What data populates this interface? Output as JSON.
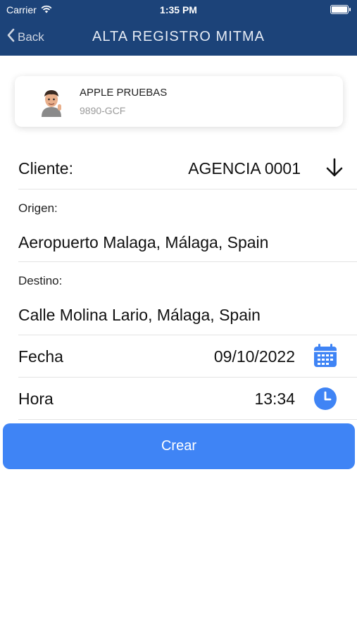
{
  "status_bar": {
    "carrier": "Carrier",
    "time": "1:35 PM"
  },
  "nav": {
    "back_label": "Back",
    "title": "ALTA REGISTRO MITMA"
  },
  "user": {
    "name": "APPLE PRUEBAS",
    "plate": "9890-GCF"
  },
  "form": {
    "cliente_label": "Cliente:",
    "cliente_value": "AGENCIA 0001",
    "origen_label": "Origen:",
    "origen_value": "Aeropuerto Malaga, Málaga, Spain",
    "destino_label": "Destino:",
    "destino_value": "Calle Molina Lario, Málaga, Spain",
    "fecha_label": "Fecha",
    "fecha_value": "09/10/2022",
    "hora_label": "Hora",
    "hora_value": "13:34"
  },
  "create_button_label": "Crear",
  "colors": {
    "nav_bg": "#1c4379",
    "accent": "#3f84f5"
  },
  "icons": [
    "wifi-icon",
    "battery-icon",
    "chevron-left-icon",
    "avatar-memoji",
    "arrow-down-icon",
    "calendar-icon",
    "clock-icon"
  ]
}
